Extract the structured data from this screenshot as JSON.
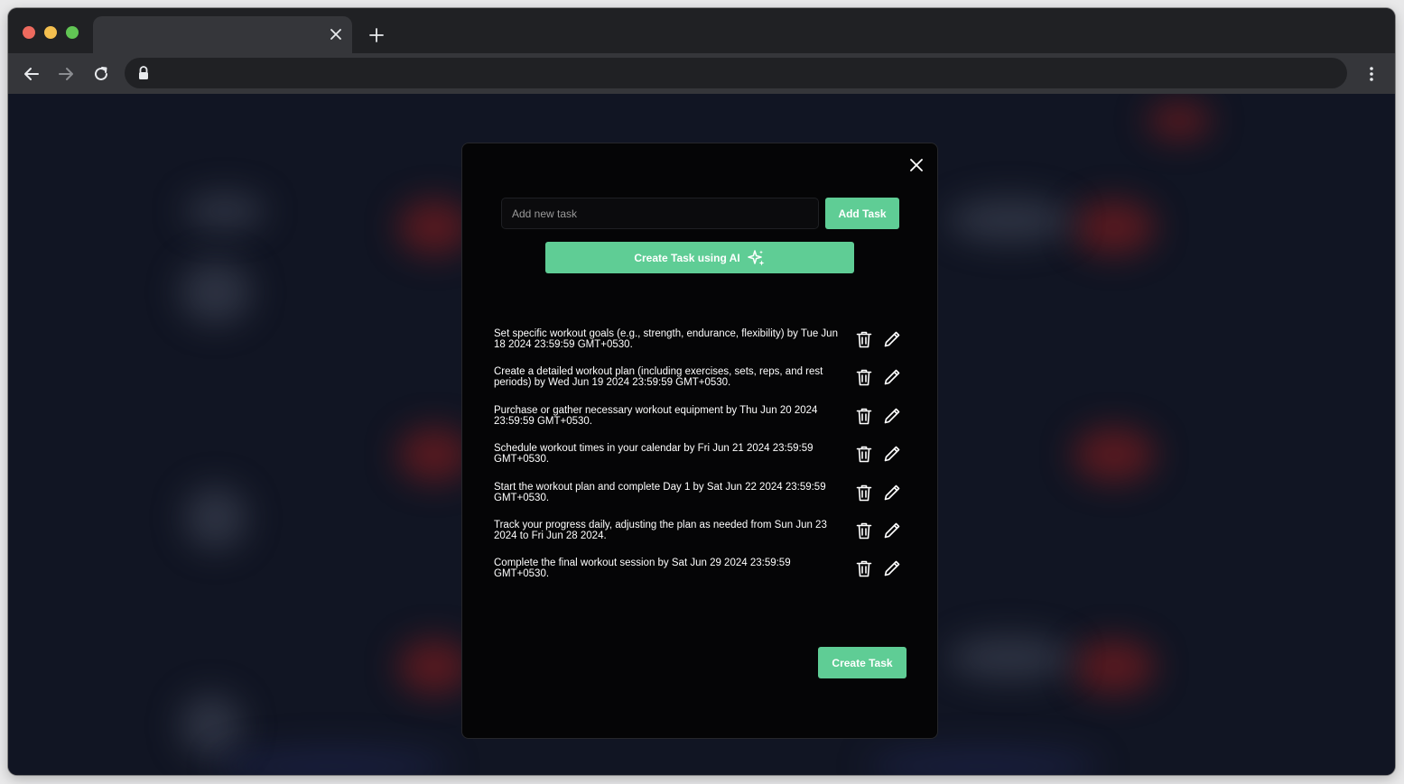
{
  "browser": {
    "tab_title": "",
    "address": ""
  },
  "modal": {
    "task_input_placeholder": "Add new task",
    "add_task_label": "Add Task",
    "ai_button_label": "Create Task using AI",
    "create_task_label": "Create Task",
    "tasks": [
      {
        "text": "Set specific workout goals (e.g., strength, endurance, flexibility) by Tue Jun 18 2024 23:59:59 GMT+0530."
      },
      {
        "text": "Create a detailed workout plan (including exercises, sets, reps, and rest periods) by Wed Jun 19 2024 23:59:59 GMT+0530."
      },
      {
        "text": "Purchase or gather necessary workout equipment by Thu Jun 20 2024 23:59:59 GMT+0530."
      },
      {
        "text": "Schedule workout times in your calendar by Fri Jun 21 2024 23:59:59 GMT+0530."
      },
      {
        "text": "Start the workout plan and complete Day 1 by Sat Jun 22 2024 23:59:59 GMT+0530."
      },
      {
        "text": "Track your progress daily, adjusting the plan as needed from Sun Jun 23 2024 to Fri Jun 28 2024."
      },
      {
        "text": "Complete the final workout session by Sat Jun 29 2024 23:59:59 GMT+0530."
      }
    ]
  },
  "icons": {
    "close": "close-icon",
    "plus": "plus-icon",
    "back": "arrow-left-icon",
    "forward": "arrow-right-icon",
    "reload": "reload-icon",
    "lock": "lock-icon",
    "menu": "more-vertical-icon",
    "sparkle": "sparkle-icon",
    "delete": "trash-icon",
    "edit": "pencil-icon"
  },
  "colors": {
    "accent": "#5fcd95",
    "modal_bg": "#050506",
    "page_bg": "#111523"
  }
}
